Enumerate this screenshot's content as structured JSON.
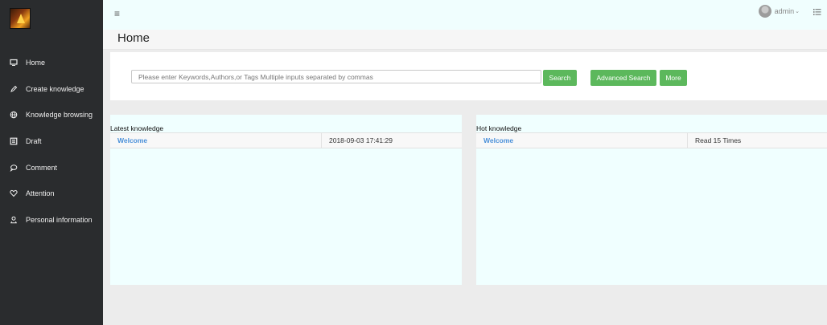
{
  "sidebar": {
    "items": [
      {
        "label": "Home",
        "icon": "monitor-icon"
      },
      {
        "label": "Create knowledge",
        "icon": "pencil-icon"
      },
      {
        "label": "Knowledge browsing",
        "icon": "globe-icon"
      },
      {
        "label": "Draft",
        "icon": "draft-icon"
      },
      {
        "label": "Comment",
        "icon": "comment-icon"
      },
      {
        "label": "Attention",
        "icon": "heart-icon"
      },
      {
        "label": "Personal information",
        "icon": "person-icon"
      }
    ]
  },
  "topbar": {
    "menu_icon": "≡",
    "user_name": "admin",
    "user_caret": "⌄"
  },
  "page": {
    "title": "Home"
  },
  "search": {
    "placeholder": "Please enter Keywords,Authors,or Tags Multiple inputs separated by commas",
    "value": "",
    "search_label": "Search",
    "advanced_label": "Advanced Search",
    "more_label": "More"
  },
  "latest": {
    "title": "Latest knowledge",
    "rows": [
      {
        "name": "Welcome",
        "date": "2018-09-03 17:41:29"
      }
    ]
  },
  "hot": {
    "title": "Hot knowledge",
    "rows": [
      {
        "name": "Welcome",
        "reads": "Read 15 Times"
      }
    ]
  },
  "colors": {
    "sidebar_bg": "#2a2c2e",
    "accent_green": "#5cb85c",
    "link_blue": "#4a90d9",
    "panel_bg": "#f0ffff"
  }
}
